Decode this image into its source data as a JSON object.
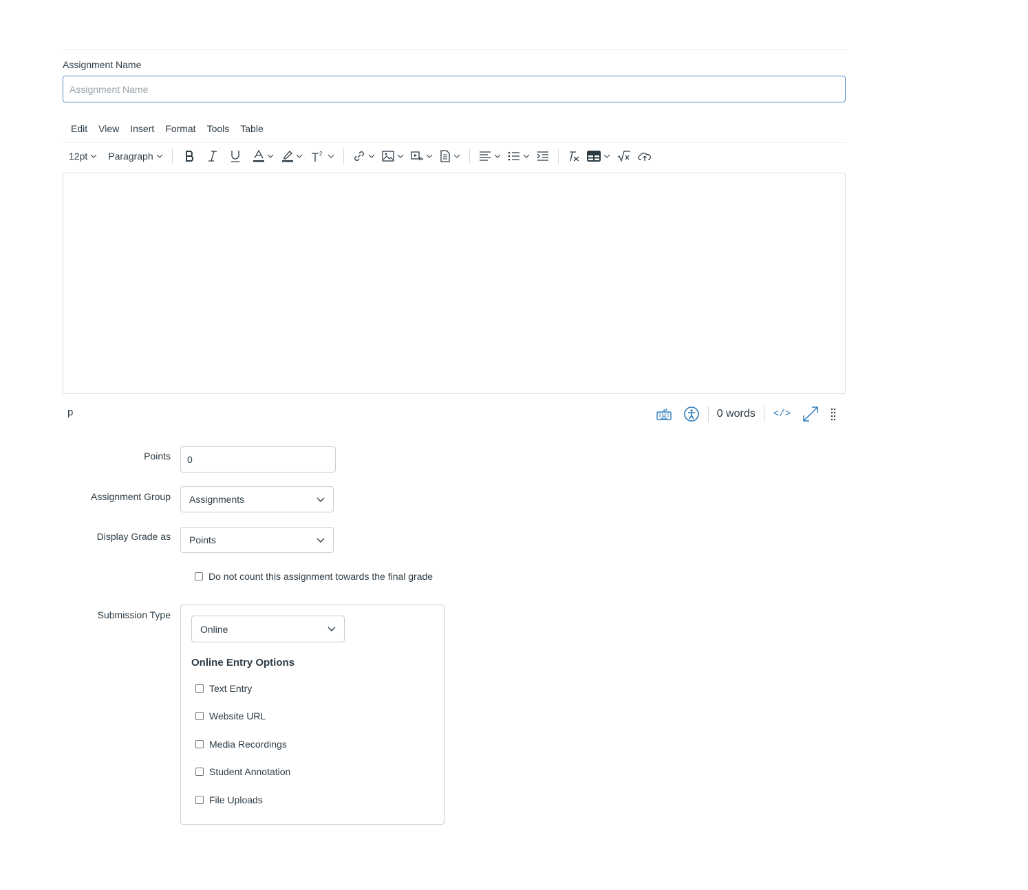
{
  "assignment_name": {
    "label": "Assignment Name",
    "placeholder": "Assignment Name"
  },
  "editor": {
    "menus": [
      "Edit",
      "View",
      "Insert",
      "Format",
      "Tools",
      "Table"
    ],
    "font_size": "12pt",
    "block_format": "Paragraph",
    "status_path": "p",
    "word_count": "0 words",
    "html_toggle_label": "</>"
  },
  "points": {
    "label": "Points",
    "value": "0"
  },
  "assignment_group": {
    "label": "Assignment Group",
    "selected": "Assignments"
  },
  "display_grade": {
    "label": "Display Grade as",
    "selected": "Points"
  },
  "final_grade_checkbox": {
    "label": "Do not count this assignment towards the final grade",
    "checked": false
  },
  "submission_type": {
    "label": "Submission Type",
    "selected": "Online",
    "options_heading": "Online Entry Options",
    "options": [
      {
        "label": "Text Entry",
        "checked": false
      },
      {
        "label": "Website URL",
        "checked": false
      },
      {
        "label": "Media Recordings",
        "checked": false
      },
      {
        "label": "Student Annotation",
        "checked": false
      },
      {
        "label": "File Uploads",
        "checked": false
      }
    ]
  },
  "colors": {
    "text": "#2d3b45",
    "link_icon": "#2b7abc",
    "border": "#c7cdd1",
    "focus_border": "#5b8fc7"
  }
}
